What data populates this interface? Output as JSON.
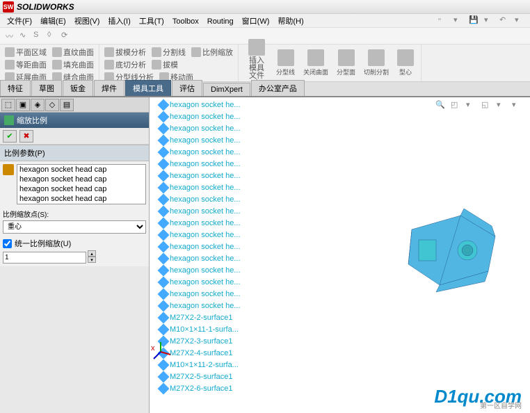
{
  "app": {
    "title": "SOLIDWORKS"
  },
  "menu": [
    "文件(F)",
    "编辑(E)",
    "视图(V)",
    "插入(I)",
    "工具(T)",
    "Toolbox",
    "Routing",
    "窗口(W)",
    "帮助(H)"
  ],
  "ribbon": {
    "g1": [
      [
        "平面区域",
        "直纹曲面"
      ],
      [
        "等距曲面",
        "填充曲面"
      ],
      [
        "延展曲面",
        "缝合曲面"
      ]
    ],
    "g2": [
      [
        "拔模分析",
        "分割线",
        "比例缩放"
      ],
      [
        "底切分析",
        "拔模",
        ""
      ],
      [
        "分型线分析",
        "移动面",
        ""
      ]
    ],
    "g3_large": "插入模具文件夹",
    "g3": [
      "分型线",
      "关闭曲面",
      "分型面",
      "切削分割",
      "型心"
    ]
  },
  "tabs": [
    "特征",
    "草图",
    "钣金",
    "焊件",
    "模具工具",
    "评估",
    "DimXpert",
    "办公室产品"
  ],
  "active_tab": 4,
  "panel": {
    "title": "缩放比例",
    "section": "比例参数(P)",
    "list": [
      "hexagon socket head cap",
      "hexagon socket head cap",
      "hexagon socket head cap",
      "hexagon socket head cap"
    ],
    "scale_label": "比例缩放点(S):",
    "scale_value": "重心",
    "uniform_label": "统一比例缩放(U)",
    "uniform_checked": true,
    "factor": "1"
  },
  "tree": [
    "hexagon socket he...",
    "hexagon socket he...",
    "hexagon socket he...",
    "hexagon socket he...",
    "hexagon socket he...",
    "hexagon socket he...",
    "hexagon socket he...",
    "hexagon socket he...",
    "hexagon socket he...",
    "hexagon socket he...",
    "hexagon socket he...",
    "hexagon socket he...",
    "hexagon socket he...",
    "hexagon socket he...",
    "hexagon socket he...",
    "hexagon socket he...",
    "hexagon socket he...",
    "hexagon socket he...",
    "M27X2-2-surface1",
    "M10×1×11-1-surfa...",
    "M27X2-3-surface1",
    "M27X2-4-surface1",
    "M10×1×11-2-surfa...",
    "M27X2-5-surface1",
    "M27X2-6-surface1"
  ],
  "watermark": {
    "main": "D1qu.com",
    "sub": "第一区自学网"
  }
}
